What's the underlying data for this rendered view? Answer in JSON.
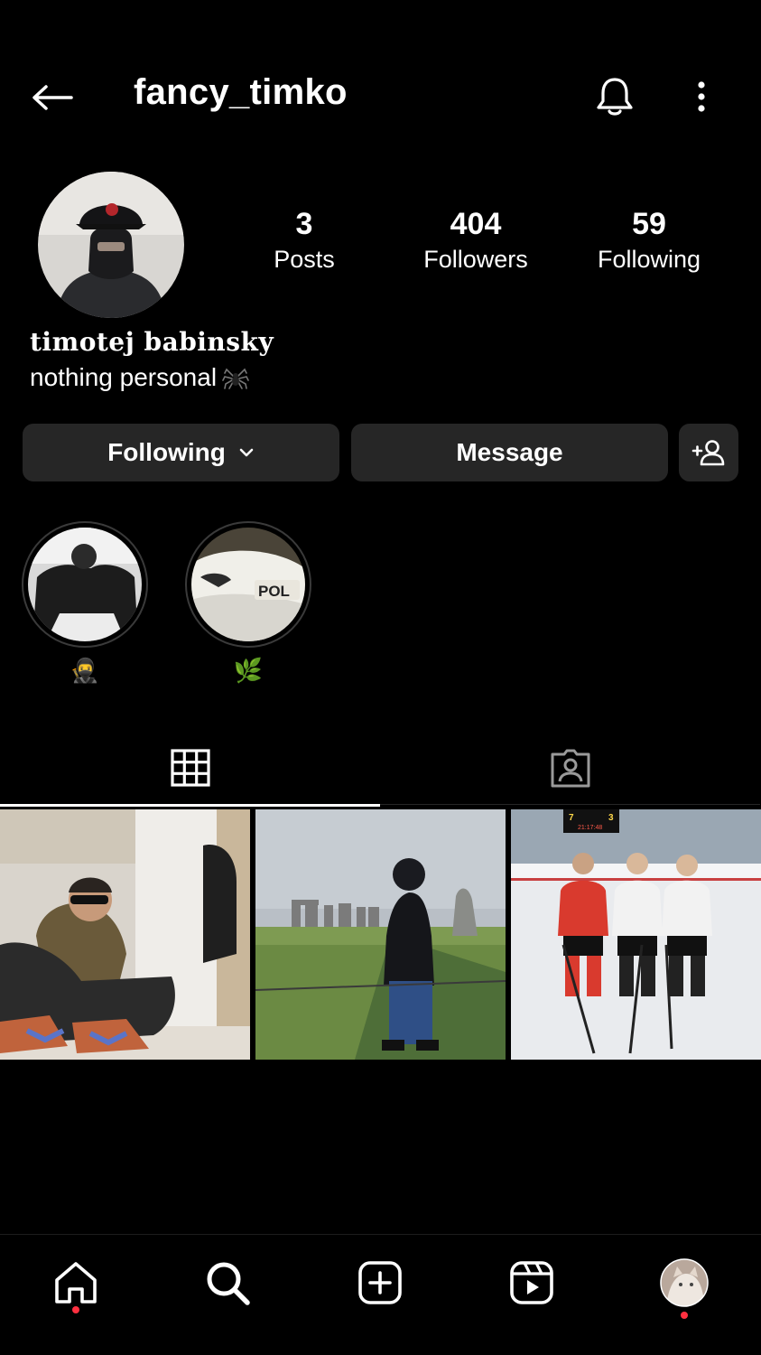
{
  "header": {
    "username": "fancy_timko",
    "back_icon": "arrow-left-icon",
    "bell_icon": "bell-icon",
    "more_icon": "more-vertical-icon"
  },
  "profile": {
    "stats": {
      "posts": {
        "count": "3",
        "label": "Posts"
      },
      "followers": {
        "count": "404",
        "label": "Followers"
      },
      "following": {
        "count": "59",
        "label": "Following"
      }
    },
    "full_name": "timotej babinsky",
    "bio": "nothing personal"
  },
  "actions": {
    "following_label": "Following",
    "message_label": "Message"
  },
  "highlights": [
    {
      "caption": "🥷"
    },
    {
      "caption": "🌿"
    }
  ],
  "tabs": [
    {
      "icon": "grid-icon",
      "active": true
    },
    {
      "icon": "tagged-person-icon",
      "active": false
    }
  ],
  "posts_count": 3,
  "nav": {
    "items": [
      "home-icon",
      "search-icon",
      "create-icon",
      "reels-icon",
      "profile-avatar"
    ],
    "notification_color": "#ff3040"
  },
  "colors": {
    "background": "#000000",
    "button": "#262626",
    "text": "#ffffff"
  }
}
